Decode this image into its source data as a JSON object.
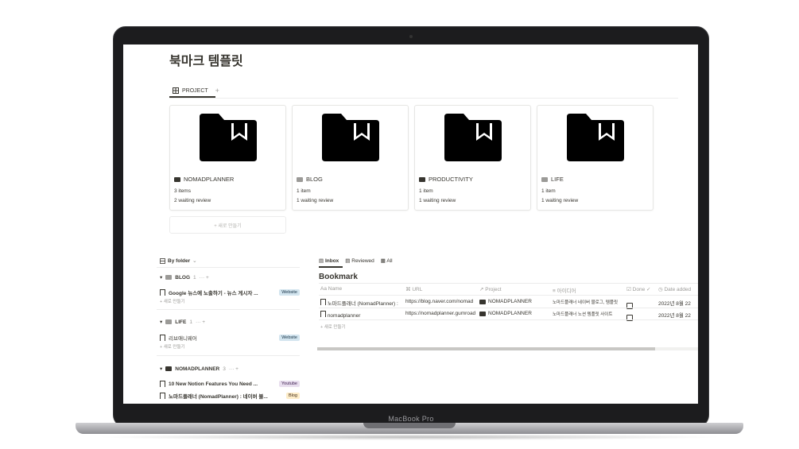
{
  "device": {
    "brand_label": "MacBook Pro"
  },
  "page": {
    "title": "북마크 템플릿"
  },
  "project_view": {
    "tab_label": "PROJECT",
    "cards": [
      {
        "title": "NOMADPLANNER",
        "items": "3 items",
        "waiting": "2 waiting review"
      },
      {
        "title": "BLOG",
        "items": "1 item",
        "waiting": "1 waiting review"
      },
      {
        "title": "PRODUCTIVITY",
        "items": "1 item",
        "waiting": "1 waiting review"
      },
      {
        "title": "LIFE",
        "items": "1 item",
        "waiting": "1 waiting review"
      }
    ],
    "new_label": "+  새로 만들기"
  },
  "by_folder": {
    "title": "By folder",
    "new_label": "+ 새로 만들기",
    "groups": [
      {
        "name": "BLOG",
        "count": "1",
        "items": [
          {
            "name": "Google 뉴스에 노출하기 - 뉴스 게시자 ...",
            "tag": "Website"
          }
        ]
      },
      {
        "name": "LIFE",
        "count": "1",
        "items": [
          {
            "name": "리브애니웨어",
            "tag": "Website"
          }
        ]
      },
      {
        "name": "NOMADPLANNER",
        "count": "3",
        "items": [
          {
            "name": "10 New Notion Features You Need ...",
            "tag": "Youtube"
          },
          {
            "name": "노마드플래너 (NomadPlanner) : 네이버 블...",
            "tag": "Blog"
          }
        ]
      }
    ]
  },
  "inbox": {
    "tabs": [
      "Inbox",
      "Reviewed",
      "All"
    ],
    "title": "Bookmark",
    "columns": [
      "Name",
      "URL",
      "Project",
      "아이디어",
      "Done ✓",
      "Date added"
    ],
    "rows": [
      {
        "name": "노마드플래너 (NomadPlanner) :",
        "url": "https://blog.naver.com/nomad",
        "project": "NOMADPLANNER",
        "idea": "노마드플래너 네이버 블로그, 템플릿",
        "date": "2022년 8월 22"
      },
      {
        "name": "nomadplanner",
        "url": "https://nomadplanner.gumroad",
        "project": "NOMADPLANNER",
        "idea": "노마드플래너 노션 템플릿 사이트",
        "date": "2022년 8월 22"
      }
    ],
    "new_label": "+ 새로 만들기"
  },
  "colors": {
    "text": "#37352f",
    "muted": "#9b9a97",
    "tag_website": "#d3e5ef",
    "tag_youtube": "#e8deee",
    "tag_blog": "#fdecc8"
  }
}
